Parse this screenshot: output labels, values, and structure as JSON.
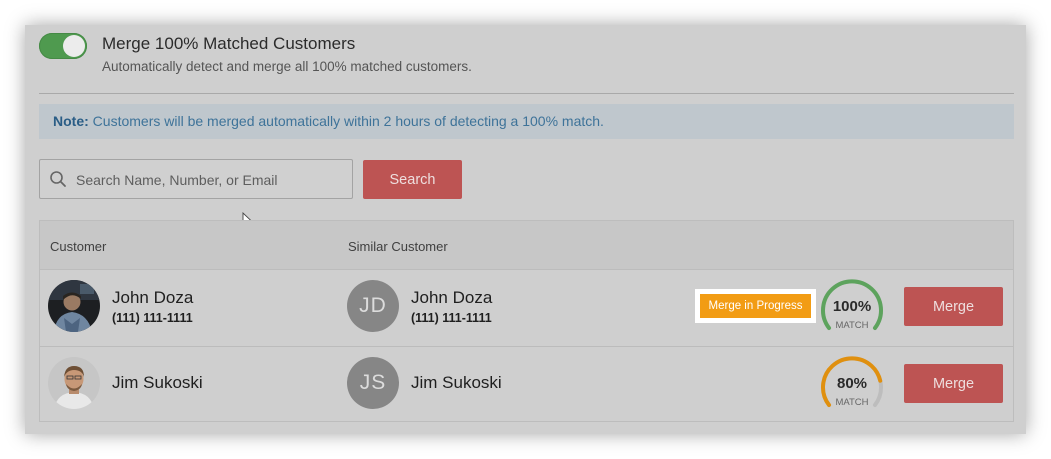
{
  "setting": {
    "title": "Merge 100% Matched Customers",
    "description": "Automatically detect and merge all 100% matched customers.",
    "toggle_on": true
  },
  "note": {
    "label": "Note:",
    "text": " Customers will be merged automatically within 2 hours of detecting a 100% match."
  },
  "search": {
    "placeholder": "Search Name, Number, or Email",
    "value": "",
    "button_label": "Search"
  },
  "table": {
    "columns": [
      "Customer",
      "Similar Customer"
    ],
    "rows": [
      {
        "customer_name": "John Doza",
        "customer_phone": "(111) 111-1111",
        "similar_initials": "JD",
        "similar_name": "John Doza",
        "similar_phone": "(111) 111-1111",
        "status": "Merge in Progress",
        "match_percent": "100%",
        "match_label": "MATCH",
        "match_value": 100,
        "merge_label": "Merge"
      },
      {
        "customer_name": "Jim Sukoski",
        "similar_initials": "JS",
        "similar_name": "Jim Sukoski",
        "match_percent": "80%",
        "match_label": "MATCH",
        "match_value": 80,
        "merge_label": "Merge"
      }
    ]
  },
  "colors": {
    "toggle_on": "#4f9a4f",
    "merge_button": "#bd5453",
    "status_badge": "#f29c14",
    "gauge_100": "#5da35d",
    "gauge_80": "#e0900f",
    "note_text": "#3e7399"
  }
}
